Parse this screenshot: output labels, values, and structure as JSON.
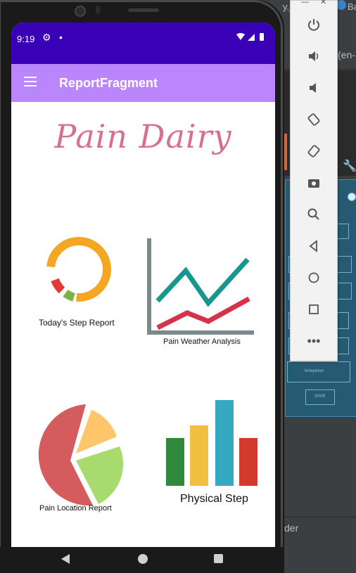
{
  "ide": {
    "top_left_text": "y.ja",
    "top_right_text": "Ba",
    "locale_text": "(en-",
    "bottom_text": "der",
    "blueprint_labels": [
      "timepicker",
      "SAVE"
    ]
  },
  "status_bar": {
    "time": "9:19",
    "icons": [
      "settings-icon",
      "dot-icon",
      "wifi-icon",
      "signal-icon",
      "battery-icon"
    ]
  },
  "app_bar": {
    "title": "ReportFragment",
    "menu_icon": "hamburger-menu-icon",
    "color": "#bb86fc"
  },
  "status_color": "#3a00b8",
  "brand": {
    "title": "Pain Dairy",
    "color": "#d86f92"
  },
  "tiles": [
    {
      "label": "Today's Step Report",
      "icon": "donut-chart-icon"
    },
    {
      "label": "Pain Weather Analysis",
      "icon": "line-chart-icon"
    },
    {
      "label": "Pain Location Report",
      "icon": "pie-chart-icon"
    },
    {
      "label": "Physical Step",
      "icon": "bar-chart-icon"
    }
  ],
  "emulator_toolbar": [
    "power-icon",
    "volume-up-icon",
    "volume-down-icon",
    "rotate-left-icon",
    "rotate-right-icon",
    "camera-icon",
    "zoom-icon",
    "back-icon",
    "home-icon",
    "overview-icon",
    "more-icon"
  ],
  "nav_bar": [
    "back-icon",
    "home-icon",
    "recent-apps-icon"
  ]
}
